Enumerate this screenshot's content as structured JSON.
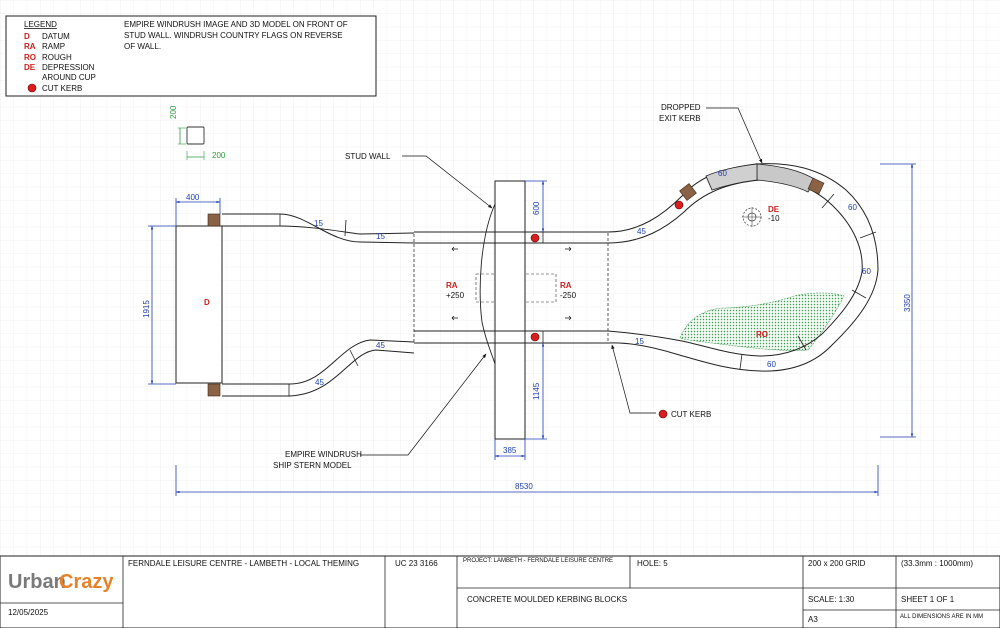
{
  "legend": {
    "title": "LEGEND",
    "items": [
      {
        "code": "D",
        "label": "DATUM"
      },
      {
        "code": "RA",
        "label": "RAMP"
      },
      {
        "code": "RO",
        "label": "ROUGH"
      },
      {
        "code": "DE",
        "label": "DEPRESSION"
      },
      {
        "code": "",
        "label": "AROUND CUP"
      },
      {
        "code": "",
        "label": "CUT KERB"
      }
    ],
    "note_lines": [
      "EMPIRE WINDRUSH IMAGE AND 3D MODEL ON FRONT OF",
      "STUD WALL. WINDRUSH COUNTRY FLAGS ON REVERSE",
      "OF WALL."
    ]
  },
  "block_dims": {
    "height": "200",
    "width": "200"
  },
  "callouts": {
    "stud_wall": "STUD WALL",
    "dropped_exit_kerb": [
      "DROPPED",
      "EXIT KERB"
    ],
    "cut_kerb": "CUT KERB",
    "ship_model": [
      "EMPIRE WINDRUSH",
      "SHIP STERN MODEL"
    ]
  },
  "zones": {
    "datum": {
      "code": "D"
    },
    "ramp_left": {
      "code": "RA",
      "value": "+250"
    },
    "ramp_right": {
      "code": "RA",
      "value": "-250"
    },
    "depression": {
      "code": "DE",
      "value": "-10"
    },
    "rough": {
      "code": "RO"
    }
  },
  "dimensions": {
    "d400": "400",
    "d1915": "1915",
    "d600": "600",
    "d1145": "1145",
    "d385": "385",
    "d3350": "3350",
    "d8530": "8530",
    "kerb_15_a": "15",
    "kerb_15_b": "15",
    "kerb_15_c": "15",
    "kerb_45_a": "45",
    "kerb_45_b": "45",
    "kerb_45_c": "45",
    "kerb_60_a": "60",
    "kerb_60_b": "60",
    "kerb_60_c": "60",
    "kerb_60_d": "60"
  },
  "title_block": {
    "logo_left": "Urban",
    "logo_right": "Crazy",
    "date": "12/05/2025",
    "site": "FERNDALE LEISURE CENTRE - LAMBETH - LOCAL THEMING",
    "ref": "UC 23 3166",
    "project": "PROJECT: LAMBETH - FERNDALE LEISURE CENTRE",
    "hole": "HOLE: 5",
    "grid": "200 x 200 GRID",
    "scale_ratio": "(33.3mm : 1000mm)",
    "description": "CONCRETE MOULDED KERBING BLOCKS",
    "scale": "SCALE: 1:30",
    "sheet": "SHEET 1 OF 1",
    "paper": "A3",
    "units_note": "ALL DIMENSIONS ARE IN MM"
  },
  "colors": {
    "dimension": "#1f3fb0",
    "zone_label": "#c81e1e",
    "logo_orange": "#e8822a",
    "grid": "#e4e4e4",
    "rough_fill": "#3d9b55"
  }
}
